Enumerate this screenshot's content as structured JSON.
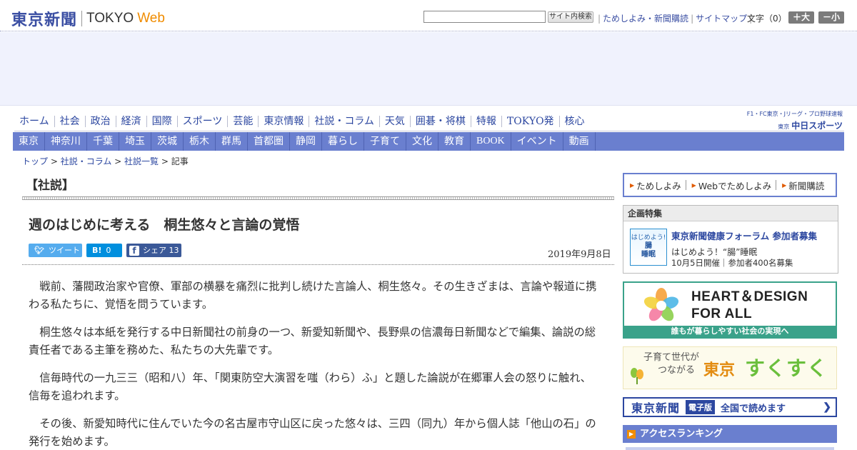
{
  "header": {
    "logo_jp": "東京新聞",
    "logo_en": "TOKYO",
    "logo_web": "Web",
    "search_button": "サイト内検索",
    "links": [
      "ためしよみ・新聞購読",
      "サイトマップ"
    ],
    "fontsize_label": "文字（0）",
    "fontsize_up": "＋大",
    "fontsize_down": "－小"
  },
  "main_nav": [
    "ホーム",
    "社会",
    "政治",
    "経済",
    "国際",
    "スポーツ",
    "芸能",
    "東京情報",
    "社説・コラム",
    "天気",
    "囲碁・将棋",
    "特報",
    "TOKYO発",
    "核心"
  ],
  "chunichi": {
    "top": "F1・FC東京・Jリーグ・プロ野球速報",
    "prefix": "東京",
    "logo": "中日スポーツ"
  },
  "region_nav": [
    "東京",
    "神奈川",
    "千葉",
    "埼玉",
    "茨城",
    "栃木",
    "群馬",
    "首都圏",
    "静岡",
    "暮らし",
    "子育て",
    "文化",
    "教育",
    "BOOK",
    "イベント",
    "動画"
  ],
  "breadcrumb": {
    "items": [
      "トップ",
      "社説・コラム",
      "社説一覧"
    ],
    "current": "記事"
  },
  "article": {
    "section": "【社説】",
    "title": "週のはじめに考える　桐生悠々と言論の覚悟",
    "date": "2019年9月8日",
    "share": {
      "tweet_label": "ツイート",
      "hatena_icon": "B!",
      "hatena_count": "0",
      "fb_icon": "f",
      "fb_label": "シェア",
      "fb_count": "13"
    },
    "paragraphs": [
      "戦前、藩閥政治家や官僚、軍部の横暴を痛烈に批判し続けた言論人、桐生悠々。その生きざまは、言論や報道に携わる私たちに、覚悟を問うています。",
      "桐生悠々は本紙を発行する中日新聞社の前身の一つ、新愛知新聞や、長野県の信濃毎日新聞などで編集、論説の総責任者である主筆を務めた、私たちの大先輩です。",
      "信毎時代の一九三三（昭和八）年、「関東防空大演習を嗤（わら）ふ」と題した論説が在郷軍人会の怒りに触れ、信毎を追われます。",
      "その後、新愛知時代に住んでいた今の名古屋市守山区に戻った悠々は、三四（同九）年から個人誌「他山の石」の発行を始めます。"
    ]
  },
  "sidebar": {
    "subscribe_links": [
      "ためしよみ",
      "Webでためしよみ",
      "新聞購読"
    ],
    "feature": {
      "heading": "企画特集",
      "thumb_top": "はじめよう!",
      "thumb_mid": "腸",
      "thumb_bottom": "睡眠",
      "title": "東京新聞健康フォーラム 参加者募集",
      "subtitle": "はじめよう！“腸”睡眠",
      "detail": "10月5日開催｜参加者400名募集"
    },
    "heart": {
      "title_line1": "HEART＆DESIGN",
      "title_line2": "FOR ALL",
      "footer": "誰もが暮らしやすい社会の実現へ"
    },
    "sukusuku": {
      "line1": "子育て世代が",
      "line2": "つながる",
      "tokyo": "東京",
      "word": "すくすく"
    },
    "denshi": {
      "logo": "東京新聞",
      "tag": "電子版",
      "text": "全国で読めます",
      "arrow": "❯"
    },
    "ranking": "アクセスランキング"
  },
  "colors": {
    "brand_blue": "#3b4fa3",
    "nav_bar": "#6a7fcf",
    "accent_orange": "#f08c00",
    "twitter": "#55acee",
    "hatena": "#008fde",
    "facebook": "#3b5998"
  }
}
